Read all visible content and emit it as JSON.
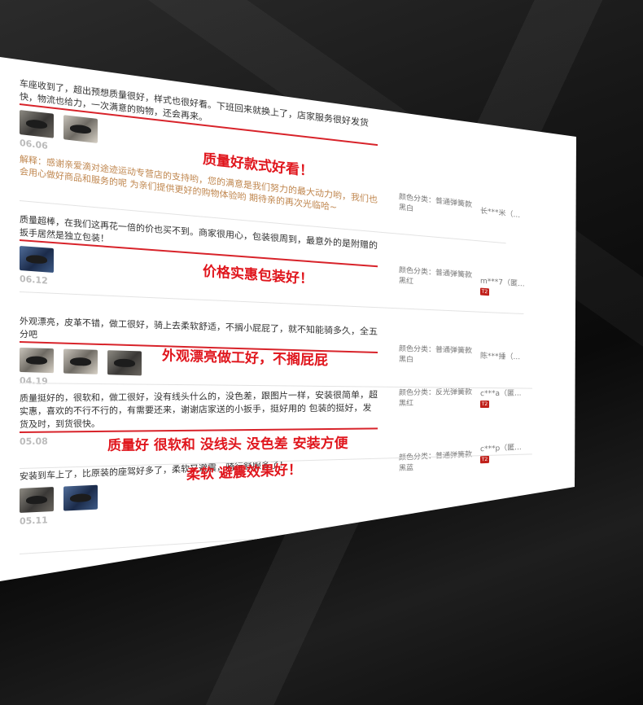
{
  "reviews": [
    {
      "text": "车座收到了，超出预想质量很好，样式也很好看。下班回来就换上了，店家服务很好发货快，物流也给力，一次满意的购物，还会再来。",
      "date": "06.06",
      "slogan": "质量好款式好看！",
      "reply": "解释：感谢亲爱滴对途迹运动专营店的支持哟，您的满意是我们努力的最大动力哟，我们也会用心做好商品和服务的呢 为亲们提供更好的购物体验哟 期待亲的再次光临哈~",
      "spec": "颜色分类：普通弹簧款黑白",
      "user": "长***米（...",
      "vip": false,
      "thumbs": 2
    },
    {
      "text": "质量超棒，在我们这再花一倍的价也买不到。商家很用心，包装很周到，最意外的是附赠的扳手居然是独立包装！",
      "date": "06.12",
      "slogan": "价格实惠包装好！",
      "spec": "颜色分类：普通弹簧款黑红",
      "user": "m***7（匿...",
      "vip": true,
      "thumbs": 1
    },
    {
      "text": "外观漂亮，皮革不错，做工很好，骑上去柔软舒适，不搁小屁屁了，就不知能骑多久，全五分吧",
      "date": "04.19",
      "slogan": "外观漂亮做工好，不搁屁屁",
      "spec": "颜色分类：普通弹簧款黑白",
      "user": "陈***捶（...",
      "vip": false,
      "thumbs": 3
    },
    {
      "text": "质量挺好的，很软和，做工很好，没有线头什么的，没色差，跟图片一样，安装很简单，超实惠，喜欢的不行不行的，有需要还来，谢谢店家送的小扳手，挺好用的 包装的挺好，发货及时，到货很快。",
      "date": "05.08",
      "slogan": "质量好 很软和 没线头 没色差 安装方便",
      "spec": "颜色分类：反光弹簧款黑红",
      "user": "c***a（匿...",
      "vip": true,
      "thumbs": 0
    },
    {
      "text": "安装到车上了，比原装的座驾好多了，柔软又避震，骑行舒服多了！",
      "date": "05.11",
      "slogan": "柔软 避震效果好！",
      "spec": "颜色分类：普通弹簧款黑蓝",
      "user": "c***p（匿...",
      "vip": true,
      "thumbs": 2
    }
  ],
  "vip_badge": "T2"
}
